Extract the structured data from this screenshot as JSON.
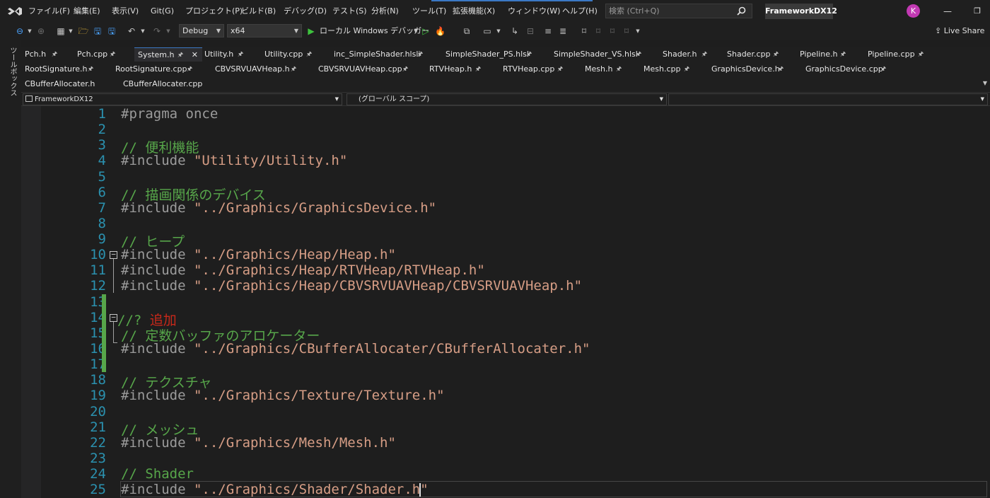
{
  "menu": {
    "items": [
      "ファイル(F)",
      "編集(E)",
      "表示(V)",
      "Git(G)",
      "プロジェクト(P)",
      "ビルド(B)",
      "デバッグ(D)",
      "テスト(S)",
      "分析(N)",
      "ツール(T)",
      "拡張機能(X)",
      "ウィンドウ(W)",
      "ヘルプ(H)"
    ],
    "search_placeholder": "検索 (Ctrl+Q)",
    "solution_name": "FrameworkDX12",
    "avatar_letter": "K",
    "minimize": "—",
    "maximize": "❐"
  },
  "toolbar": {
    "configuration": "Debug",
    "platform": "x64",
    "run_target": "ローカル Windows デバッガー",
    "live_share": "Live Share"
  },
  "toolbox_label": "ツールボックス",
  "tabs": {
    "row1": [
      "Pch.h",
      "Pch.cpp",
      "System.h",
      "Utility.h",
      "Utility.cpp",
      "inc_SimpleShader.hlsli",
      "SimpleShader_PS.hlsl",
      "SimpleShader_VS.hlsl",
      "Shader.h",
      "Shader.cpp",
      "Pipeline.h",
      "Pipeline.cpp"
    ],
    "row2": [
      "RootSignature.h",
      "RootSignature.cpp",
      "CBVSRVUAVHeap.h",
      "CBVSRVUAVHeap.cpp",
      "RTVHeap.h",
      "RTVHeap.cpp",
      "Mesh.h",
      "Mesh.cpp",
      "GraphicsDevice.h",
      "GraphicsDevice.cpp"
    ],
    "row3": [
      "CBufferAllocater.h",
      "CBufferAllocater.cpp"
    ],
    "active": "System.h"
  },
  "navbar": {
    "project": "FrameworkDX12",
    "scope": "(グローバル スコープ)",
    "member": ""
  },
  "code": {
    "line_numbers": [
      "1",
      "2",
      "3",
      "4",
      "5",
      "6",
      "7",
      "8",
      "9",
      "10",
      "11",
      "12",
      "13",
      "14",
      "15",
      "16",
      "17",
      "18",
      "19",
      "20",
      "21",
      "22",
      "23",
      "24",
      "25"
    ],
    "l1": "#pragma once",
    "l3": "// 便利機能",
    "l4_kw": "#include ",
    "l4_str": "\"Utility/Utility.h\"",
    "l6": "// 描画関係のデバイス",
    "l7_kw": "#include ",
    "l7_str": "\"../Graphics/GraphicsDevice.h\"",
    "l9": "// ヒープ",
    "l10_kw": "#include ",
    "l10_str": "\"../Graphics/Heap/Heap.h\"",
    "l11_kw": "#include ",
    "l11_str": "\"../Graphics/Heap/RTVHeap/RTVHeap.h\"",
    "l12_kw": "#include ",
    "l12_str": "\"../Graphics/Heap/CBVSRVUAVHeap/CBVSRVUAVHeap.h\"",
    "l14_cm": "//? ",
    "l14_red": "追加",
    "l15": "// 定数バッファのアロケーター",
    "l16_kw": "#include ",
    "l16_str": "\"../Graphics/CBufferAllocater/CBufferAllocater.h\"",
    "l18": "// テクスチャ",
    "l19_kw": "#include ",
    "l19_str": "\"../Graphics/Texture/Texture.h\"",
    "l21": "// メッシュ",
    "l22_kw": "#include ",
    "l22_str": "\"../Graphics/Mesh/Mesh.h\"",
    "l24": "// Shader",
    "l25_kw": "#include ",
    "l25_str": "\"../Graphics/Shader/Shader.h\""
  }
}
